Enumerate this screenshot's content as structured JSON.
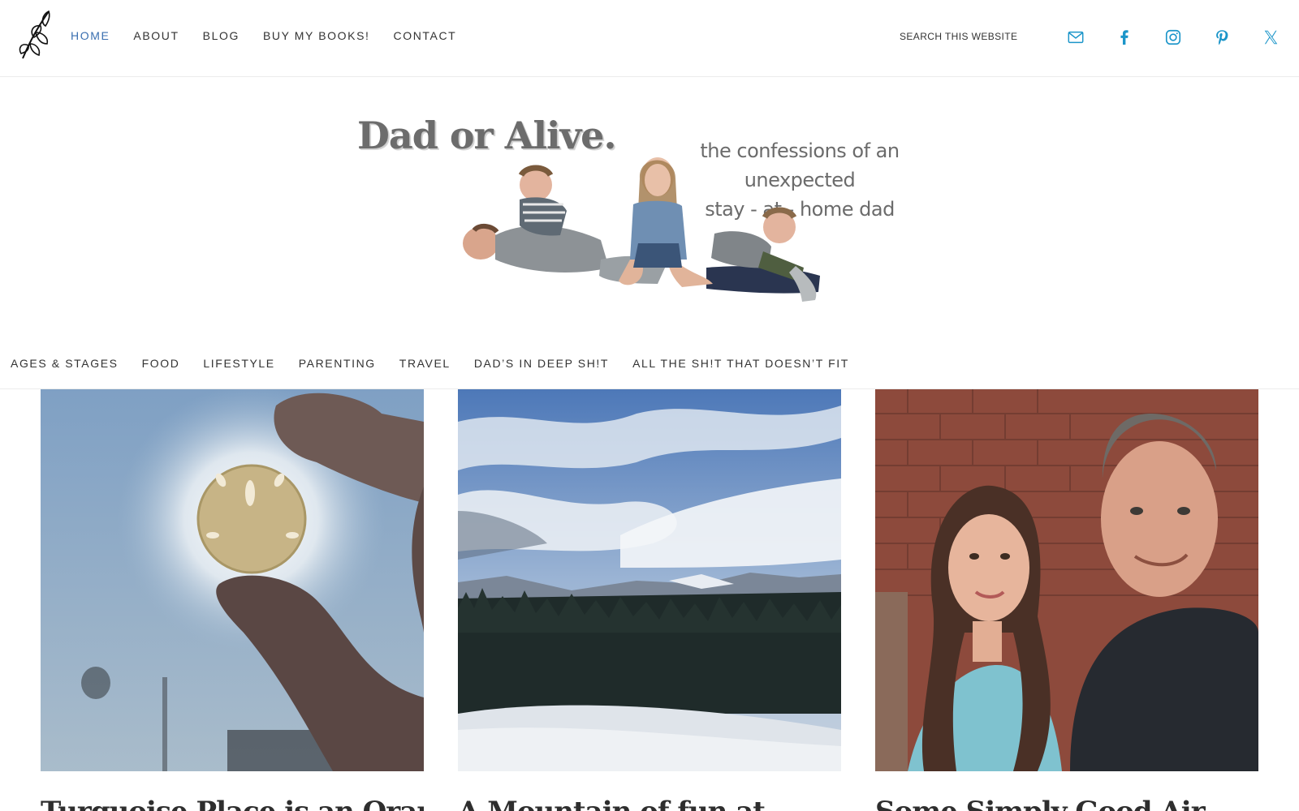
{
  "header": {
    "nav": [
      {
        "label": "HOME",
        "active": true
      },
      {
        "label": "ABOUT",
        "active": false
      },
      {
        "label": "BLOG",
        "active": false
      },
      {
        "label": "BUY MY BOOKS!",
        "active": false
      },
      {
        "label": "CONTACT",
        "active": false
      }
    ],
    "search_placeholder": "SEARCH THIS WEBSITE",
    "social_icons": [
      "email-icon",
      "facebook-icon",
      "instagram-icon",
      "pinterest-icon",
      "x-icon"
    ],
    "social_color": "#1b95c9",
    "active_color": "#3a6fb0"
  },
  "hero": {
    "brand": "Dad or Alive.",
    "tagline_line1": "the confessions of an unexpected",
    "tagline_line2": "stay - at - home dad"
  },
  "categories": [
    "AGES & STAGES",
    "FOOD",
    "LIFESTYLE",
    "PARENTING",
    "TRAVEL",
    "DAD’S IN DEEP SH!T",
    "ALL THE SH!T THAT DOESN’T FIT"
  ],
  "posts": [
    {
      "title": "Turquoise Place is an Orange"
    },
    {
      "title": "A Mountain of fun at"
    },
    {
      "title": "Some Simply Good Air"
    }
  ]
}
